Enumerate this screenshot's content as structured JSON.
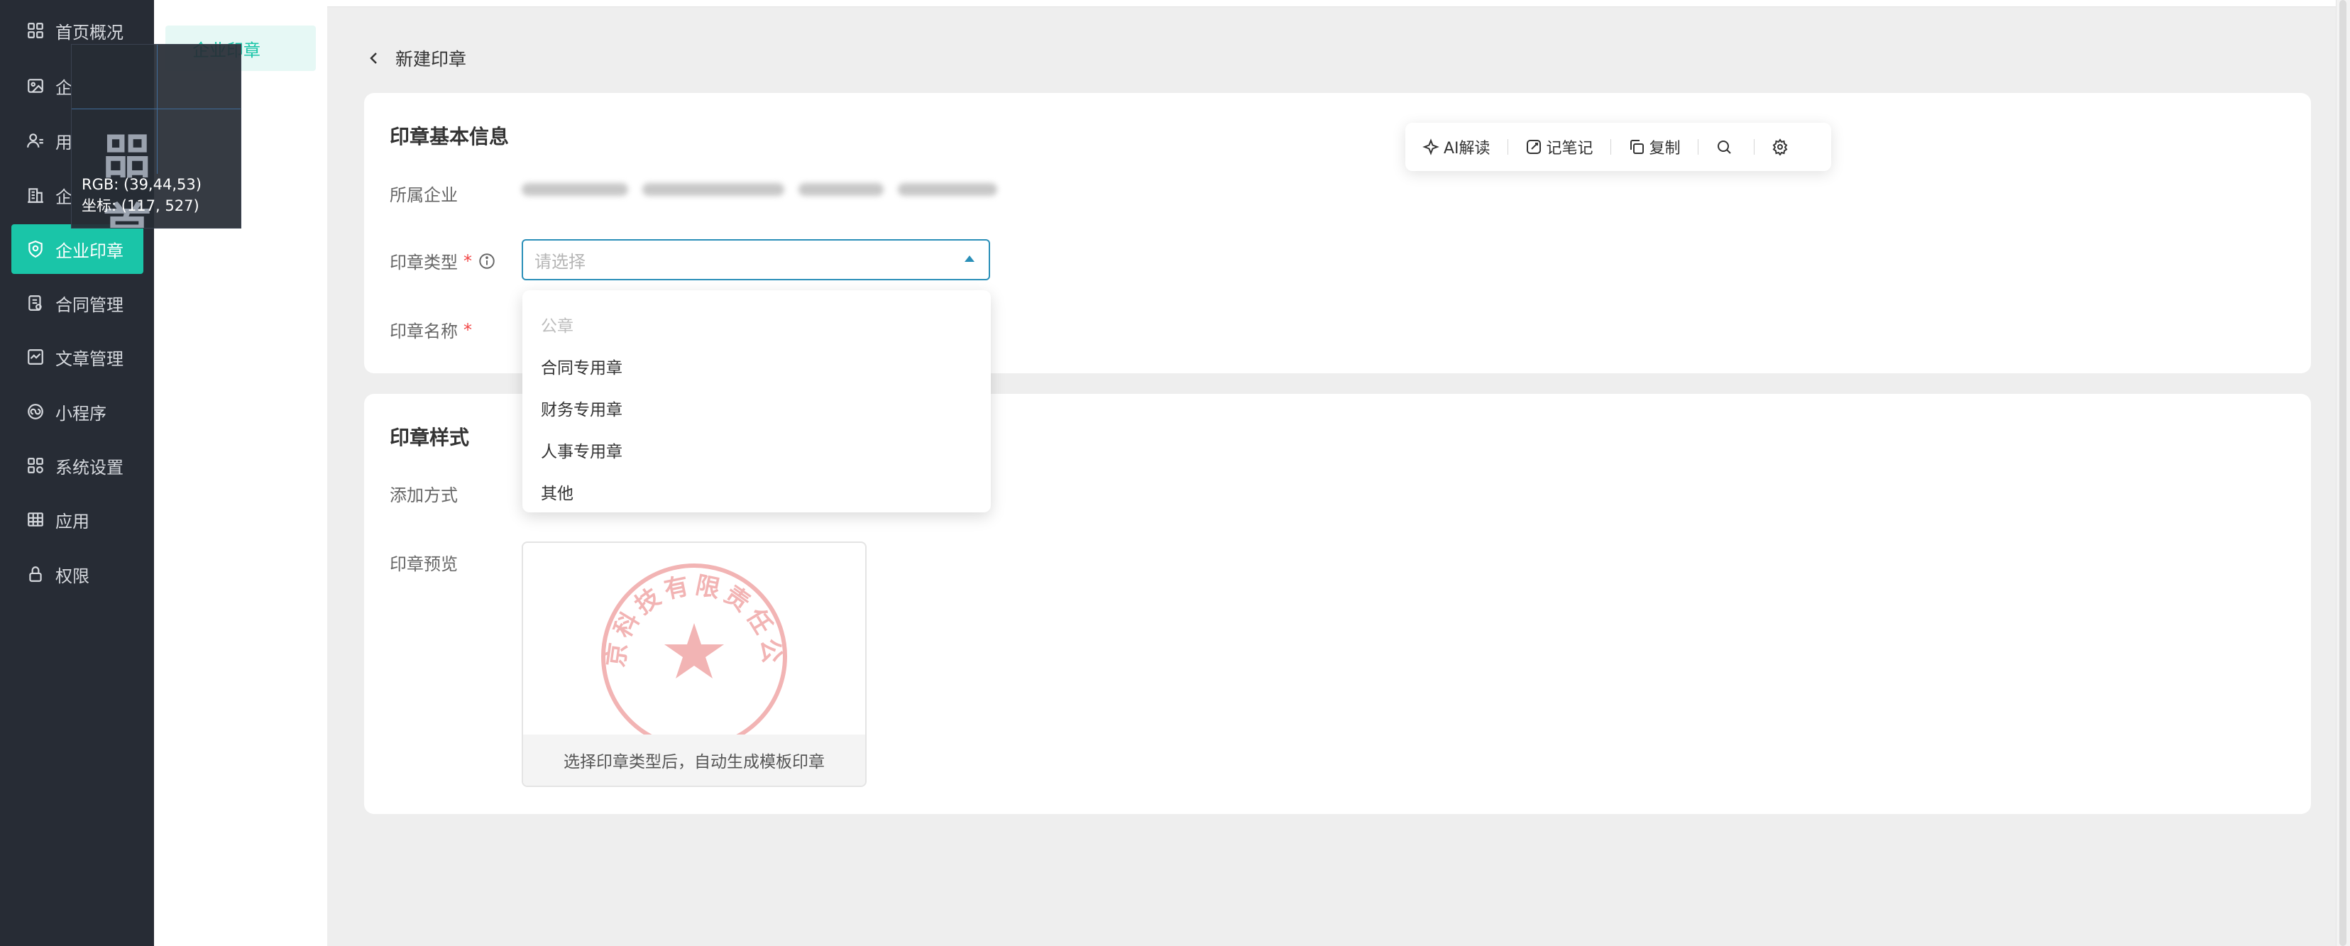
{
  "sidebar": {
    "items": [
      {
        "label": "首页概况",
        "icon": "grid-icon"
      },
      {
        "label": "企",
        "icon": "image-icon"
      },
      {
        "label": "用",
        "icon": "users-icon"
      },
      {
        "label": "企",
        "icon": "building-icon"
      },
      {
        "label": "企业印章",
        "icon": "shield-icon",
        "active": true
      },
      {
        "label": "合同管理",
        "icon": "contract-icon"
      },
      {
        "label": "文章管理",
        "icon": "article-icon"
      },
      {
        "label": "小程序",
        "icon": "miniprogram-icon"
      },
      {
        "label": "系统设置",
        "icon": "settings-grid-icon"
      },
      {
        "label": "应用",
        "icon": "apps-icon"
      },
      {
        "label": "权限",
        "icon": "lock-icon"
      }
    ]
  },
  "submenu": {
    "active_item": "企业印章"
  },
  "inspector": {
    "glyphs": "㗊 首",
    "rgb": "RGB: (39,44,53)",
    "coord": "坐标: (117, 527)"
  },
  "page": {
    "back_title": "新建印章"
  },
  "basic_info": {
    "title": "印章基本信息",
    "company_label": "所属企业",
    "type_label": "印章类型",
    "type_placeholder": "请选择",
    "name_label": "印章名称",
    "required_mark": "*"
  },
  "type_dropdown": {
    "options": [
      {
        "label": "公章",
        "disabled": true
      },
      {
        "label": "合同专用章",
        "disabled": false
      },
      {
        "label": "财务专用章",
        "disabled": false
      },
      {
        "label": "人事专用章",
        "disabled": false
      },
      {
        "label": "其他",
        "disabled": false
      }
    ]
  },
  "style_section": {
    "title": "印章样式",
    "add_method_label": "添加方式",
    "preview_label": "印章预览",
    "preview_caption": "选择印章类型后，自动生成模板印章",
    "seal_text": "北京科技有限责任公司"
  },
  "float_toolbar": {
    "ai_label": "AI解读",
    "note_label": "记笔记",
    "copy_label": "复制"
  },
  "colors": {
    "accent": "#1ac5a8",
    "sidebar_bg": "#272c35",
    "select_border": "#2a8fb8",
    "required": "#f24646",
    "seal_red": "#f2b4b4"
  }
}
